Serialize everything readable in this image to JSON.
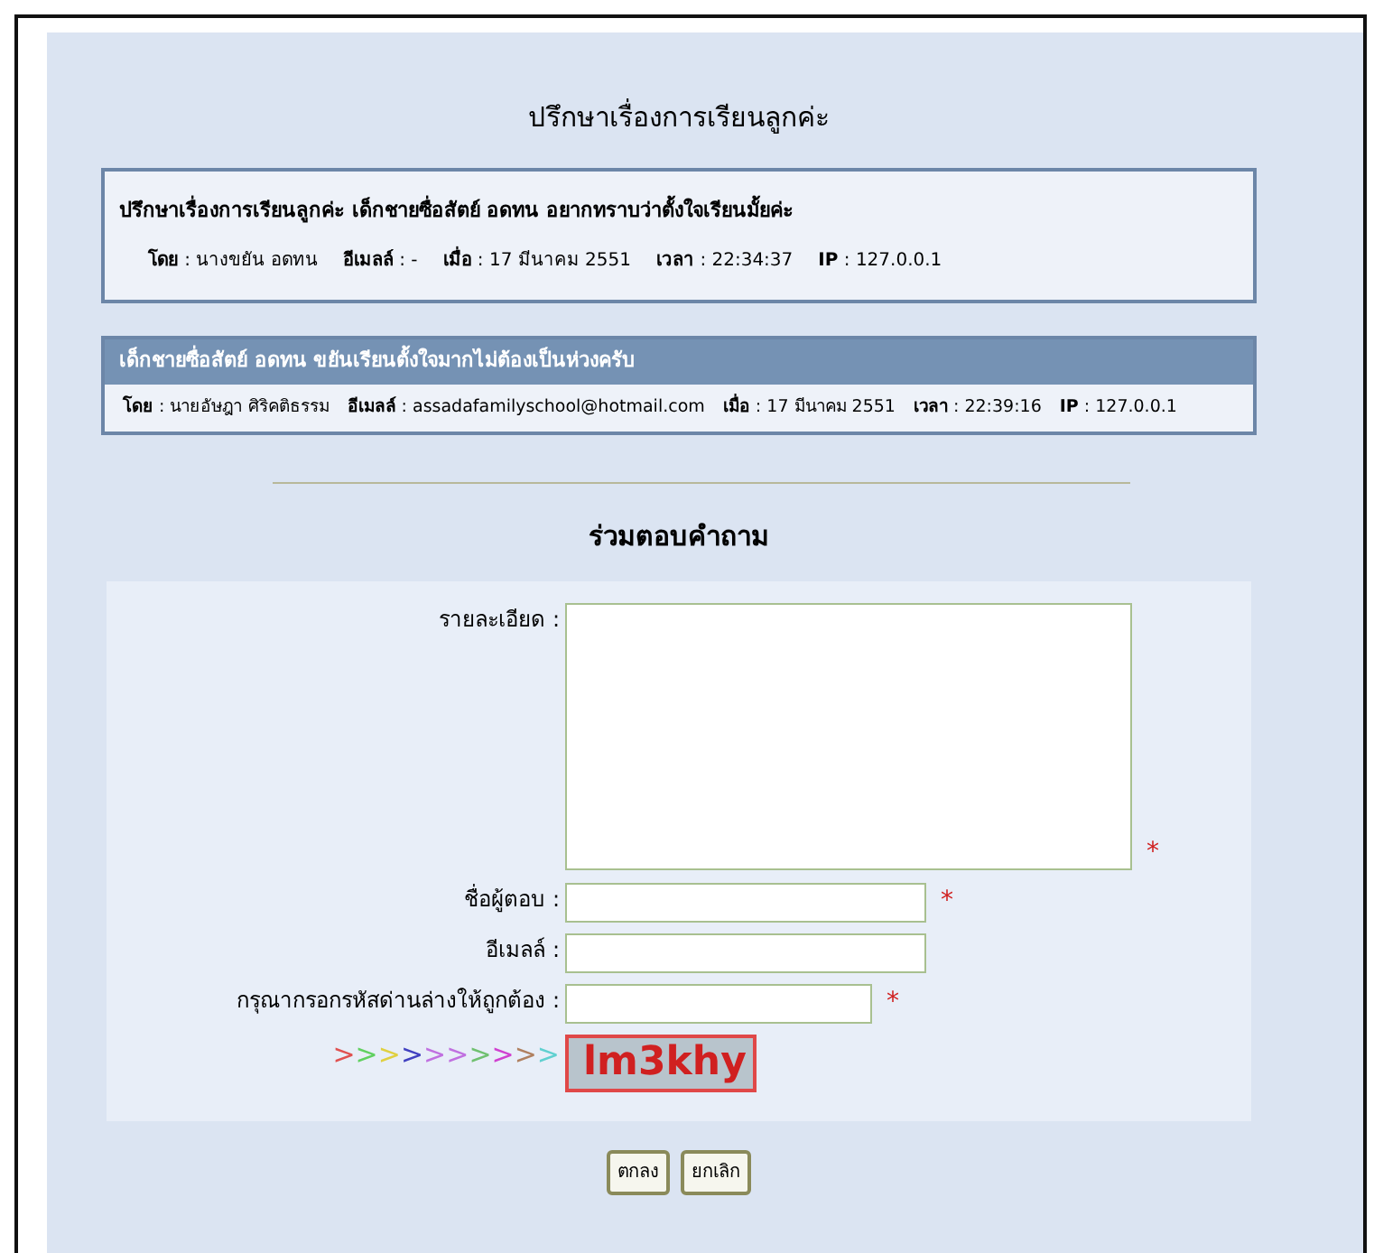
{
  "page_title": "ปรึกษาเรื่องการเรียนลูกค่ะ",
  "question": {
    "title": "ปรึกษาเรื่องการเรียนลูกค่ะ เด็กชายซื่อสัตย์ อดทน อยากทราบว่าตั้งใจเรียนมั้ยค่ะ",
    "meta": [
      "**โดย** : นางขยัน อดทน",
      "**อีเมลล์** : -",
      "**เมื่อ** : 17 มีนาคม 2551",
      "**เวลา** : 22:34:37",
      "**IP** : 127.0.0.1"
    ]
  },
  "replies": [
    {
      "title": "เด็กชายซื่อสัตย์ อดทน ขยันเรียนตั้งใจมากไม่ต้องเป็นห่วงครับ",
      "meta": [
        "**โดย** : นายอัษฎา ศิริคติธรรม",
        "**อีเมลล์** : assadafamilyschool@hotmail.com",
        "**เมื่อ** : 17 มีนาคม 2551",
        "**เวลา** : 22:39:16",
        "**IP** : 127.0.0.1"
      ]
    }
  ],
  "answer_form": {
    "heading": "ร่วมตอบคำถาม",
    "fields": [
      {
        "kind": "textarea",
        "label": "รายละเอียด :",
        "required_mark": "*"
      },
      {
        "kind": "text",
        "label": "ชื่อผู้ตอบ :",
        "required_mark": "*"
      },
      {
        "kind": "text",
        "label": "อีเมลล์ :"
      },
      {
        "kind": "code",
        "label": "กรุณากรอกรหัสด่านล่างให้ถูกต้อง :",
        "required_mark": "*"
      }
    ],
    "captcha": {
      "arrows": [
        {
          "text": ">",
          "color": "#e05050"
        },
        {
          "text": ">",
          "color": "#60d060"
        },
        {
          "text": ">",
          "color": "#e0d040"
        },
        {
          "text": ">",
          "color": "#4040c0"
        },
        {
          "text": ">",
          "color": "#c070e0"
        },
        {
          "text": ">",
          "color": "#c070e0"
        },
        {
          "text": ">",
          "color": "#70c070"
        },
        {
          "text": ">",
          "color": "#d040d0"
        },
        {
          "text": ">",
          "color": "#b08060"
        },
        {
          "text": ">",
          "color": "#60d0d0"
        }
      ],
      "code": "lm3khy"
    },
    "buttons": [
      "ตกลง",
      "ยกเลิก"
    ]
  }
}
